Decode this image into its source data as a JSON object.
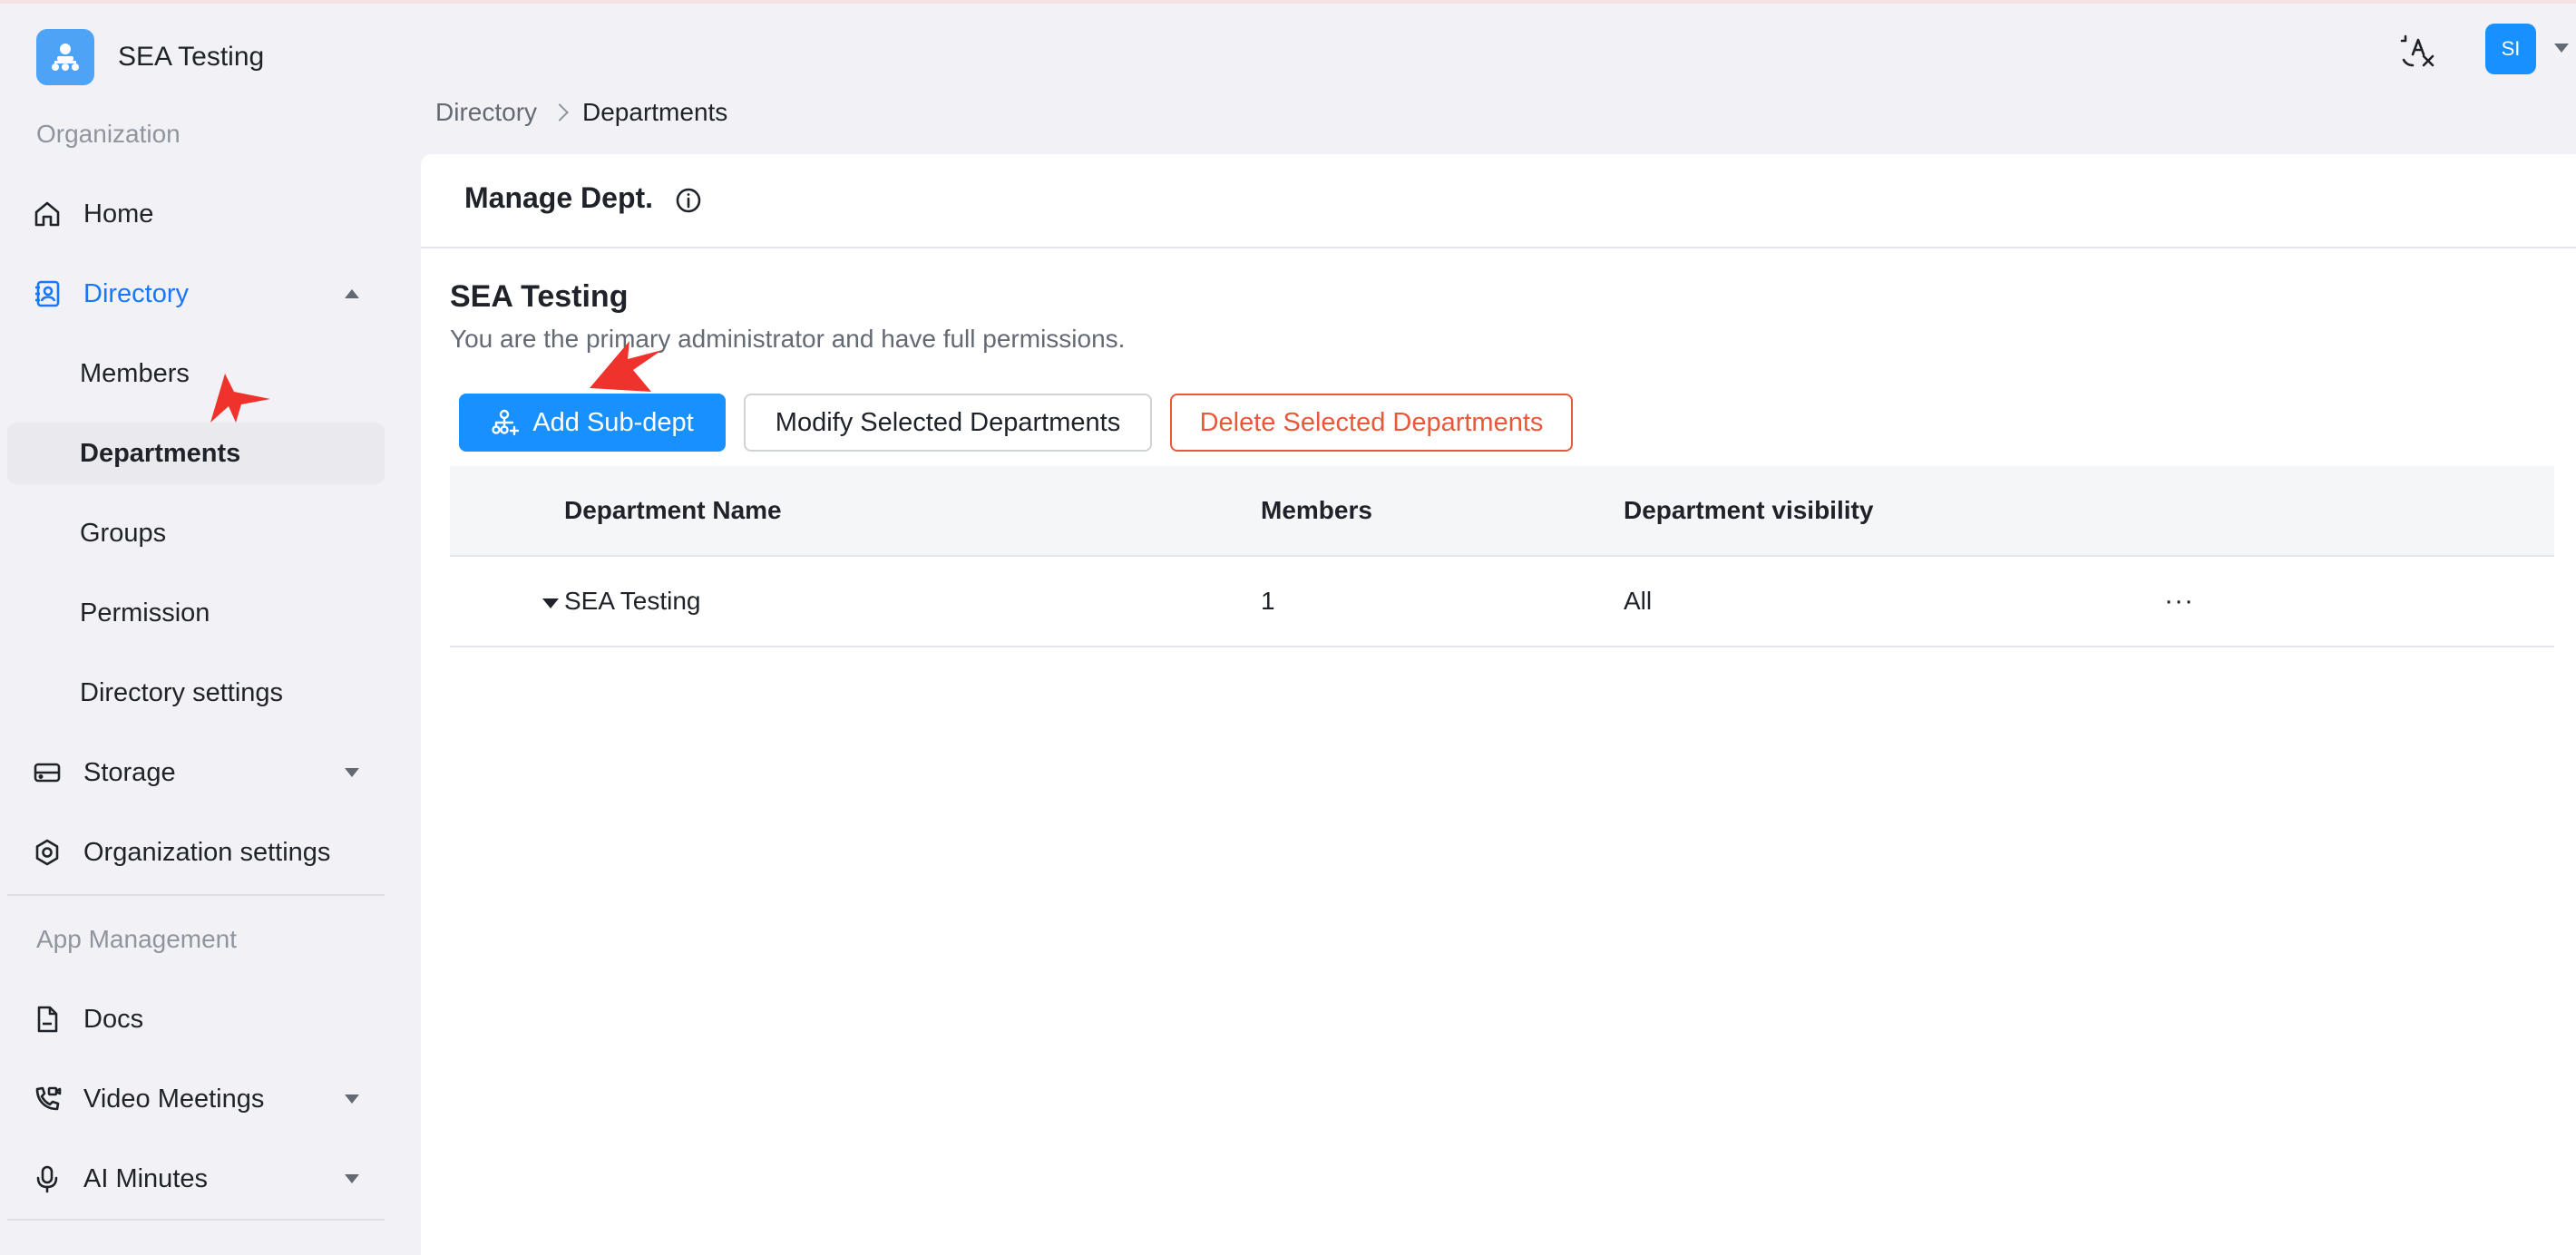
{
  "app": {
    "name": "SEA Testing"
  },
  "sidebar": {
    "org_section": "Organization",
    "home": "Home",
    "directory": "Directory",
    "directory_sub": [
      "Members",
      "Departments",
      "Groups",
      "Permission",
      "Directory settings"
    ],
    "storage": "Storage",
    "org_settings": "Organization settings",
    "app_section": "App Management",
    "docs": "Docs",
    "video_meetings": "Video Meetings",
    "ai_minutes": "AI Minutes"
  },
  "header": {
    "avatar_initials": "SI"
  },
  "breadcrumb": {
    "parent": "Directory",
    "current": "Departments"
  },
  "panel": {
    "title": "Manage Dept.",
    "org_name": "SEA Testing",
    "org_desc": "You are the primary administrator and have full permissions."
  },
  "actions": {
    "add": "Add Sub-dept",
    "modify": "Modify Selected Departments",
    "delete": "Delete Selected Departments"
  },
  "table": {
    "columns": [
      "Department Name",
      "Members",
      "Department visibility"
    ],
    "rows": [
      {
        "name": "SEA Testing",
        "members": "1",
        "visibility": "All",
        "more": "···"
      }
    ]
  },
  "colors": {
    "accent": "#1890ff",
    "danger": "#e8583a",
    "brand_logo": "#4da3f6",
    "annotation": "#f0322d"
  }
}
